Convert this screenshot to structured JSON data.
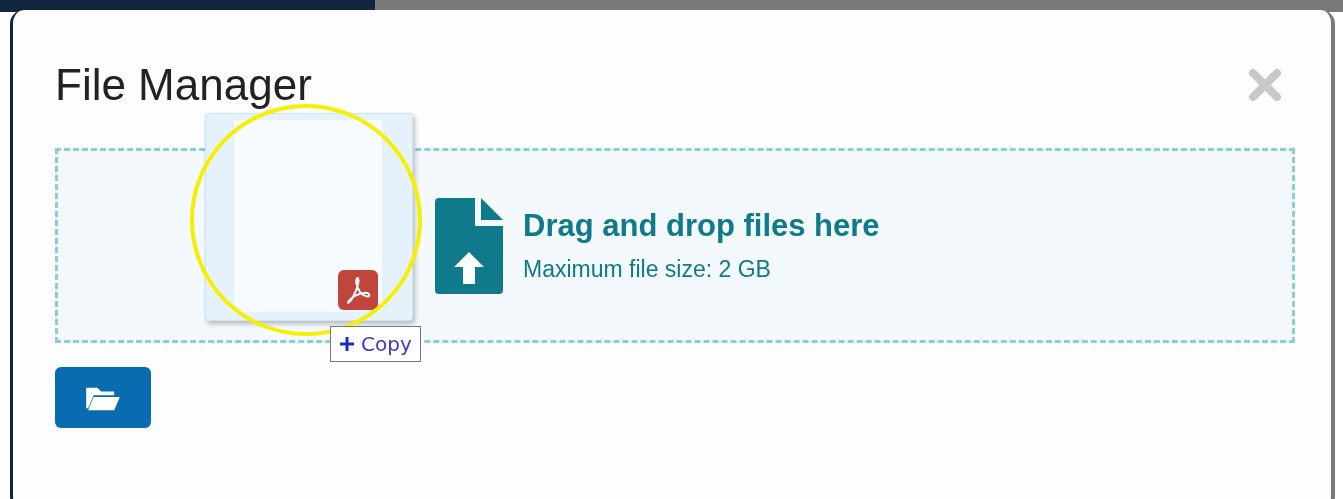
{
  "dialog": {
    "title": "File Manager"
  },
  "dropzone": {
    "heading": "Drag and drop files here",
    "subtext": "Maximum file size: 2 GB"
  },
  "drag_cursor": {
    "label": "Copy"
  }
}
